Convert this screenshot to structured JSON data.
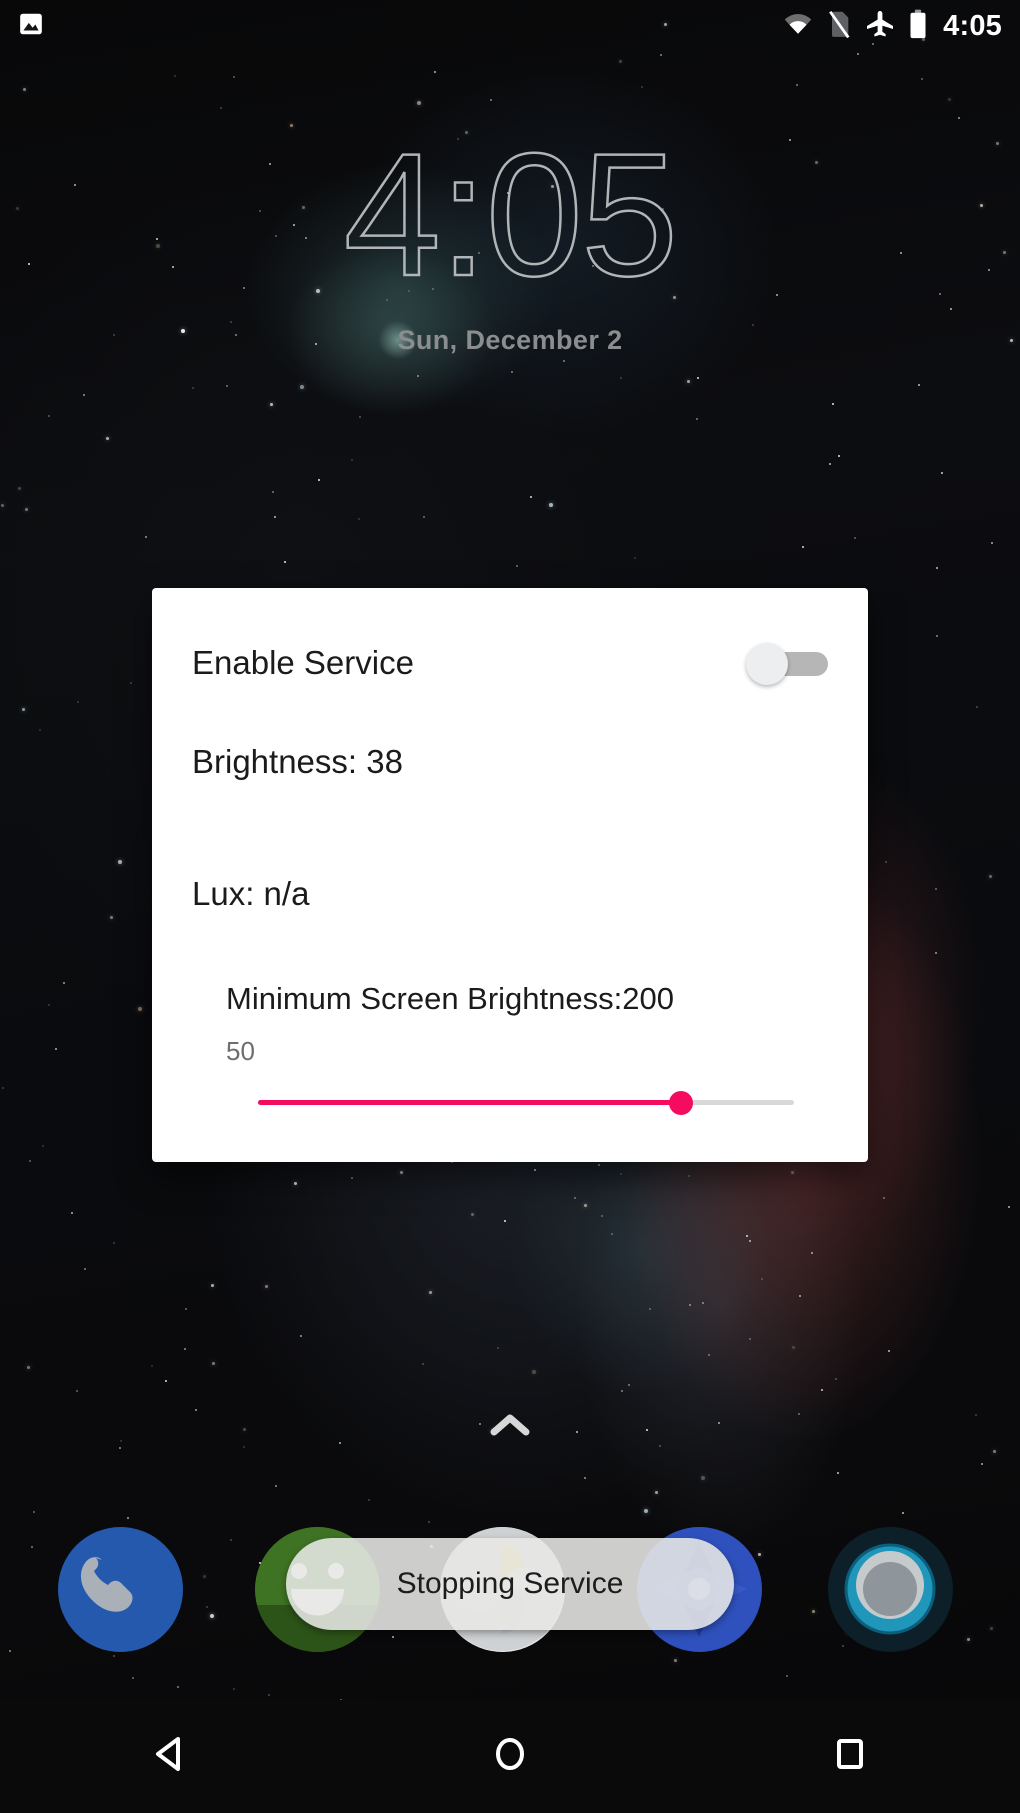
{
  "status_bar": {
    "left_icons": [
      {
        "name": "photo-notification-icon",
        "glyph": "image"
      }
    ],
    "right_icons": [
      {
        "name": "wifi-icon",
        "glyph": "wifi"
      },
      {
        "name": "no-sim-icon",
        "glyph": "no-sim"
      },
      {
        "name": "airplane-mode-icon",
        "glyph": "airplane"
      },
      {
        "name": "battery-icon",
        "glyph": "battery-full"
      }
    ],
    "clock": "4:05"
  },
  "clock_widget": {
    "time": "4:05",
    "date": "Sun, December 2"
  },
  "dialog": {
    "enable_service": {
      "label": "Enable Service",
      "toggle_state": "off"
    },
    "brightness": {
      "label": "Brightness: 38",
      "value": 38
    },
    "lux": {
      "label": "Lux: n/a",
      "value": "n/a"
    },
    "min_brightness": {
      "label": "Minimum Screen Brightness:200",
      "value": 200,
      "slider_min_label": "50",
      "slider_percent": 79,
      "accent_color": "#f50b60",
      "rail_color": "#d8d8d8"
    }
  },
  "drawer": {
    "chevron_icon": "chevron-up-icon"
  },
  "dock": {
    "items": [
      {
        "name": "dock-item-phone",
        "label": "Phone"
      },
      {
        "name": "dock-item-messages",
        "label": "Messages"
      },
      {
        "name": "dock-item-photos",
        "label": "Photos"
      },
      {
        "name": "dock-item-maps",
        "label": "Maps"
      },
      {
        "name": "dock-item-camera",
        "label": "Camera"
      }
    ]
  },
  "toast": {
    "message": "Stopping Service"
  },
  "nav_bar": {
    "buttons": [
      {
        "name": "nav-back-button",
        "icon": "back-triangle-icon"
      },
      {
        "name": "nav-home-button",
        "icon": "home-circle-icon"
      },
      {
        "name": "nav-recents-button",
        "icon": "recents-square-icon"
      }
    ]
  }
}
